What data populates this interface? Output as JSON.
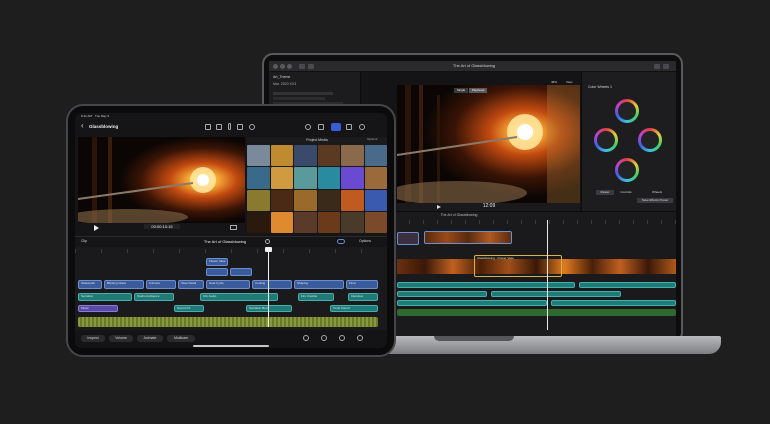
{
  "macbook": {
    "window_title": "The Art of Glassblowing",
    "library_name": "Art_Theme",
    "event_label": "Mar. 2020 XX3",
    "viewer_zoom": "48%",
    "viewer_view_menu": "View",
    "viewer_single_button": "Single",
    "viewer_playhead_button": "Playhead",
    "timecode": "12:09",
    "timeline_title": "The Art of Glassblowing",
    "inspector_title": "Color Wheels 1",
    "inspector_tab_1": "Master",
    "inspector_tab_2": "Controls",
    "inspector_preset_label": "Save Effects Preset",
    "inspector_view_label": "Wheels",
    "timeline_clip_label": "Glassblowing - Flower Vase"
  },
  "ipad": {
    "status_time": "9:41 AM",
    "status_date": "Tue May 9",
    "project_name": "Glassblowing",
    "browser_title": "Project Media",
    "browser_options": "Options",
    "timecode": "00:00:10:15",
    "timeline_title": "The Art of Glassblowing",
    "timeline_options": "Options",
    "timeline_left_label": "Clip",
    "bottom_buttons": [
      "Inspect",
      "Volume",
      "Animate",
      "Multicam"
    ],
    "clips": {
      "track1": [
        "Flower Vase"
      ],
      "track2": [
        "Glasswork",
        "Blowing Glass",
        "Furnace",
        "Vase Detail",
        "Heat Cycle",
        "Cooling",
        "Shaping",
        "Final"
      ],
      "track3": [
        "Narration",
        "Studio Ambience",
        "Kiln Audio",
        "Fire Crackle",
        "Interview"
      ],
      "track4": [
        "Music",
        "Sound FX",
        "Narration Bed",
        "Tools Sound"
      ]
    }
  },
  "colors": {
    "background": "#1e1e1f",
    "accent_blue": "#3a5c9c",
    "accent_teal": "#1f7a78",
    "accent_green": "#3a7a3a",
    "accent_purple": "#5a4aa8",
    "selection_yellow": "#d9b34a"
  }
}
